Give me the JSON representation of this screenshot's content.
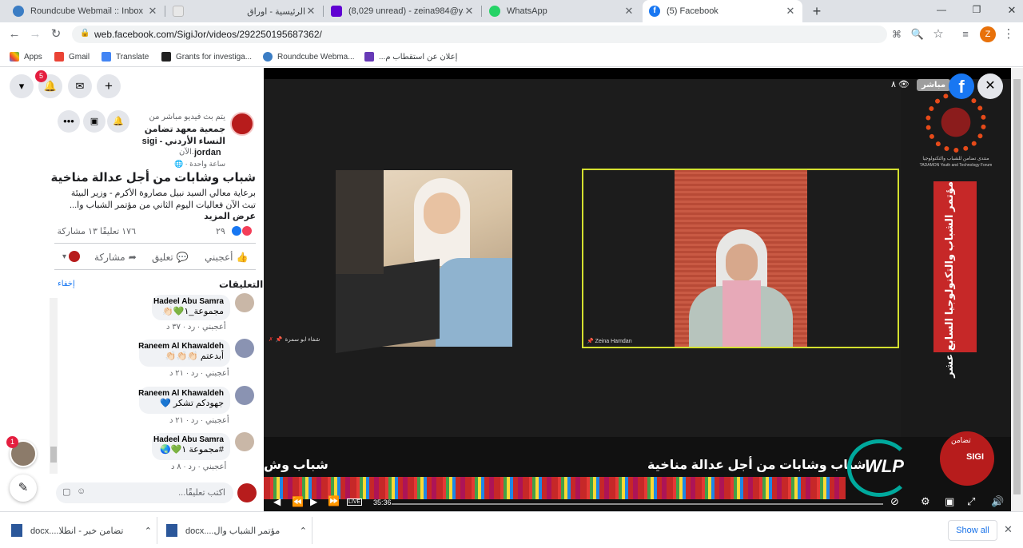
{
  "tabs": [
    {
      "title": "Roundcube Webmail :: Inbox",
      "color": "#3b7dc4",
      "active": false
    },
    {
      "title": "الرئيسية - اوراق",
      "color": "#e8e8e8",
      "active": false
    },
    {
      "title": "(8,029 unread) - zeina984@yahoo",
      "color": "#6001d2",
      "active": false
    },
    {
      "title": "WhatsApp",
      "color": "#25d366",
      "active": false
    },
    {
      "title": "(5) Facebook",
      "color": "#1877f2",
      "active": true
    }
  ],
  "window_controls": {
    "minimize": "—",
    "maximize": "❐",
    "close": "✕",
    "new_tab": "+"
  },
  "address": {
    "secure_icon": "🔒",
    "url": "web.facebook.com/SigiJor/videos/292250195687362/"
  },
  "profile_initial": "Z",
  "bookmarks": [
    {
      "label": "Apps",
      "color": "#4285f4"
    },
    {
      "label": "Gmail",
      "color": "#ea4335"
    },
    {
      "label": "Translate",
      "color": "#4285f4"
    },
    {
      "label": "Grants for investiga...",
      "color": "#222"
    },
    {
      "label": "Roundcube Webma...",
      "color": "#3b7dc4"
    },
    {
      "label": "إعلان عن استقطاب م...",
      "color": "#673ab7"
    }
  ],
  "fb": {
    "notif_count": "5",
    "post": {
      "status": "يتم بث فيديو مباشر من",
      "page_name_1": "جمعية معهد تضامن",
      "page_name_2": "النساء الأردني - sigi",
      "page_name_3": "jordan",
      "time_now": "الآن.",
      "time_ago": "ساعة واحدة",
      "title": "شباب وشابات من أجل عدالة مناخية",
      "desc_1": "برعاية معالي السيد نبيل مصاروة الأكرم - وزير البيئة",
      "desc_2": "تبث الآن فعاليات اليوم الثاني من مؤتمر الشباب وا...",
      "see_more": "عرض المزيد",
      "reactions_count": "٢٩",
      "comments_shares": "١٧٦ تعليقًا  ١٣ مشاركة",
      "like": "أعجبني",
      "comment": "تعليق",
      "share": "مشاركة"
    },
    "comments_header": "التعليقات",
    "hide": "إخفاء",
    "comments": [
      {
        "name": "Hadeel Abu Samra",
        "text": "مجموعة_١💚👏🏻",
        "meta": "أعجبني · رد · ٣٧ د",
        "avatar": "#c9b7a7"
      },
      {
        "name": "Raneem Al Khawaldeh",
        "text": "أبدعتم 👏🏻👏🏻👏🏻",
        "meta": "أعجبني · رد · ٢١ د",
        "avatar": "#8a93b2"
      },
      {
        "name": "Raneem Al Khawaldeh",
        "text": "جهودكم تشكر 💙",
        "meta": "أعجبني · رد · ٢١ د",
        "avatar": "#8a93b2"
      },
      {
        "name": "Hadeel Abu Samra",
        "text": "#مجموعة ١💚🌏",
        "meta": "أعجبني · رد · ٨ د",
        "avatar": "#c9b7a7"
      }
    ],
    "write_placeholder": "اكتب تعليقًا...",
    "chat_badge": "1"
  },
  "video": {
    "views": "٨",
    "live_badge": "مباشر",
    "participant_left": "شفاء ابو سمرة",
    "participant_right": "Zeina Hamdan",
    "forum_name": "منتدى تضامن للشباب والتكنولوجيا",
    "forum_name_en": "TADAMON Youth and Technology Forum",
    "banner_text": "مؤتمر الشباب والتكنولوجيا السابع عشر",
    "lower_title": "شباب وشابات من أجل عدالة مناخية",
    "lower_title_2": "شباب وش",
    "wlp": "WLP",
    "sigi": "SIGI",
    "tadamon": "تضامن",
    "time": "35:36",
    "live": "LIVE"
  },
  "downloads": [
    {
      "name": "تضامن خبر - انطلا....docx"
    },
    {
      "name": "مؤتمر الشباب وال....docx"
    }
  ],
  "show_all": "Show all"
}
